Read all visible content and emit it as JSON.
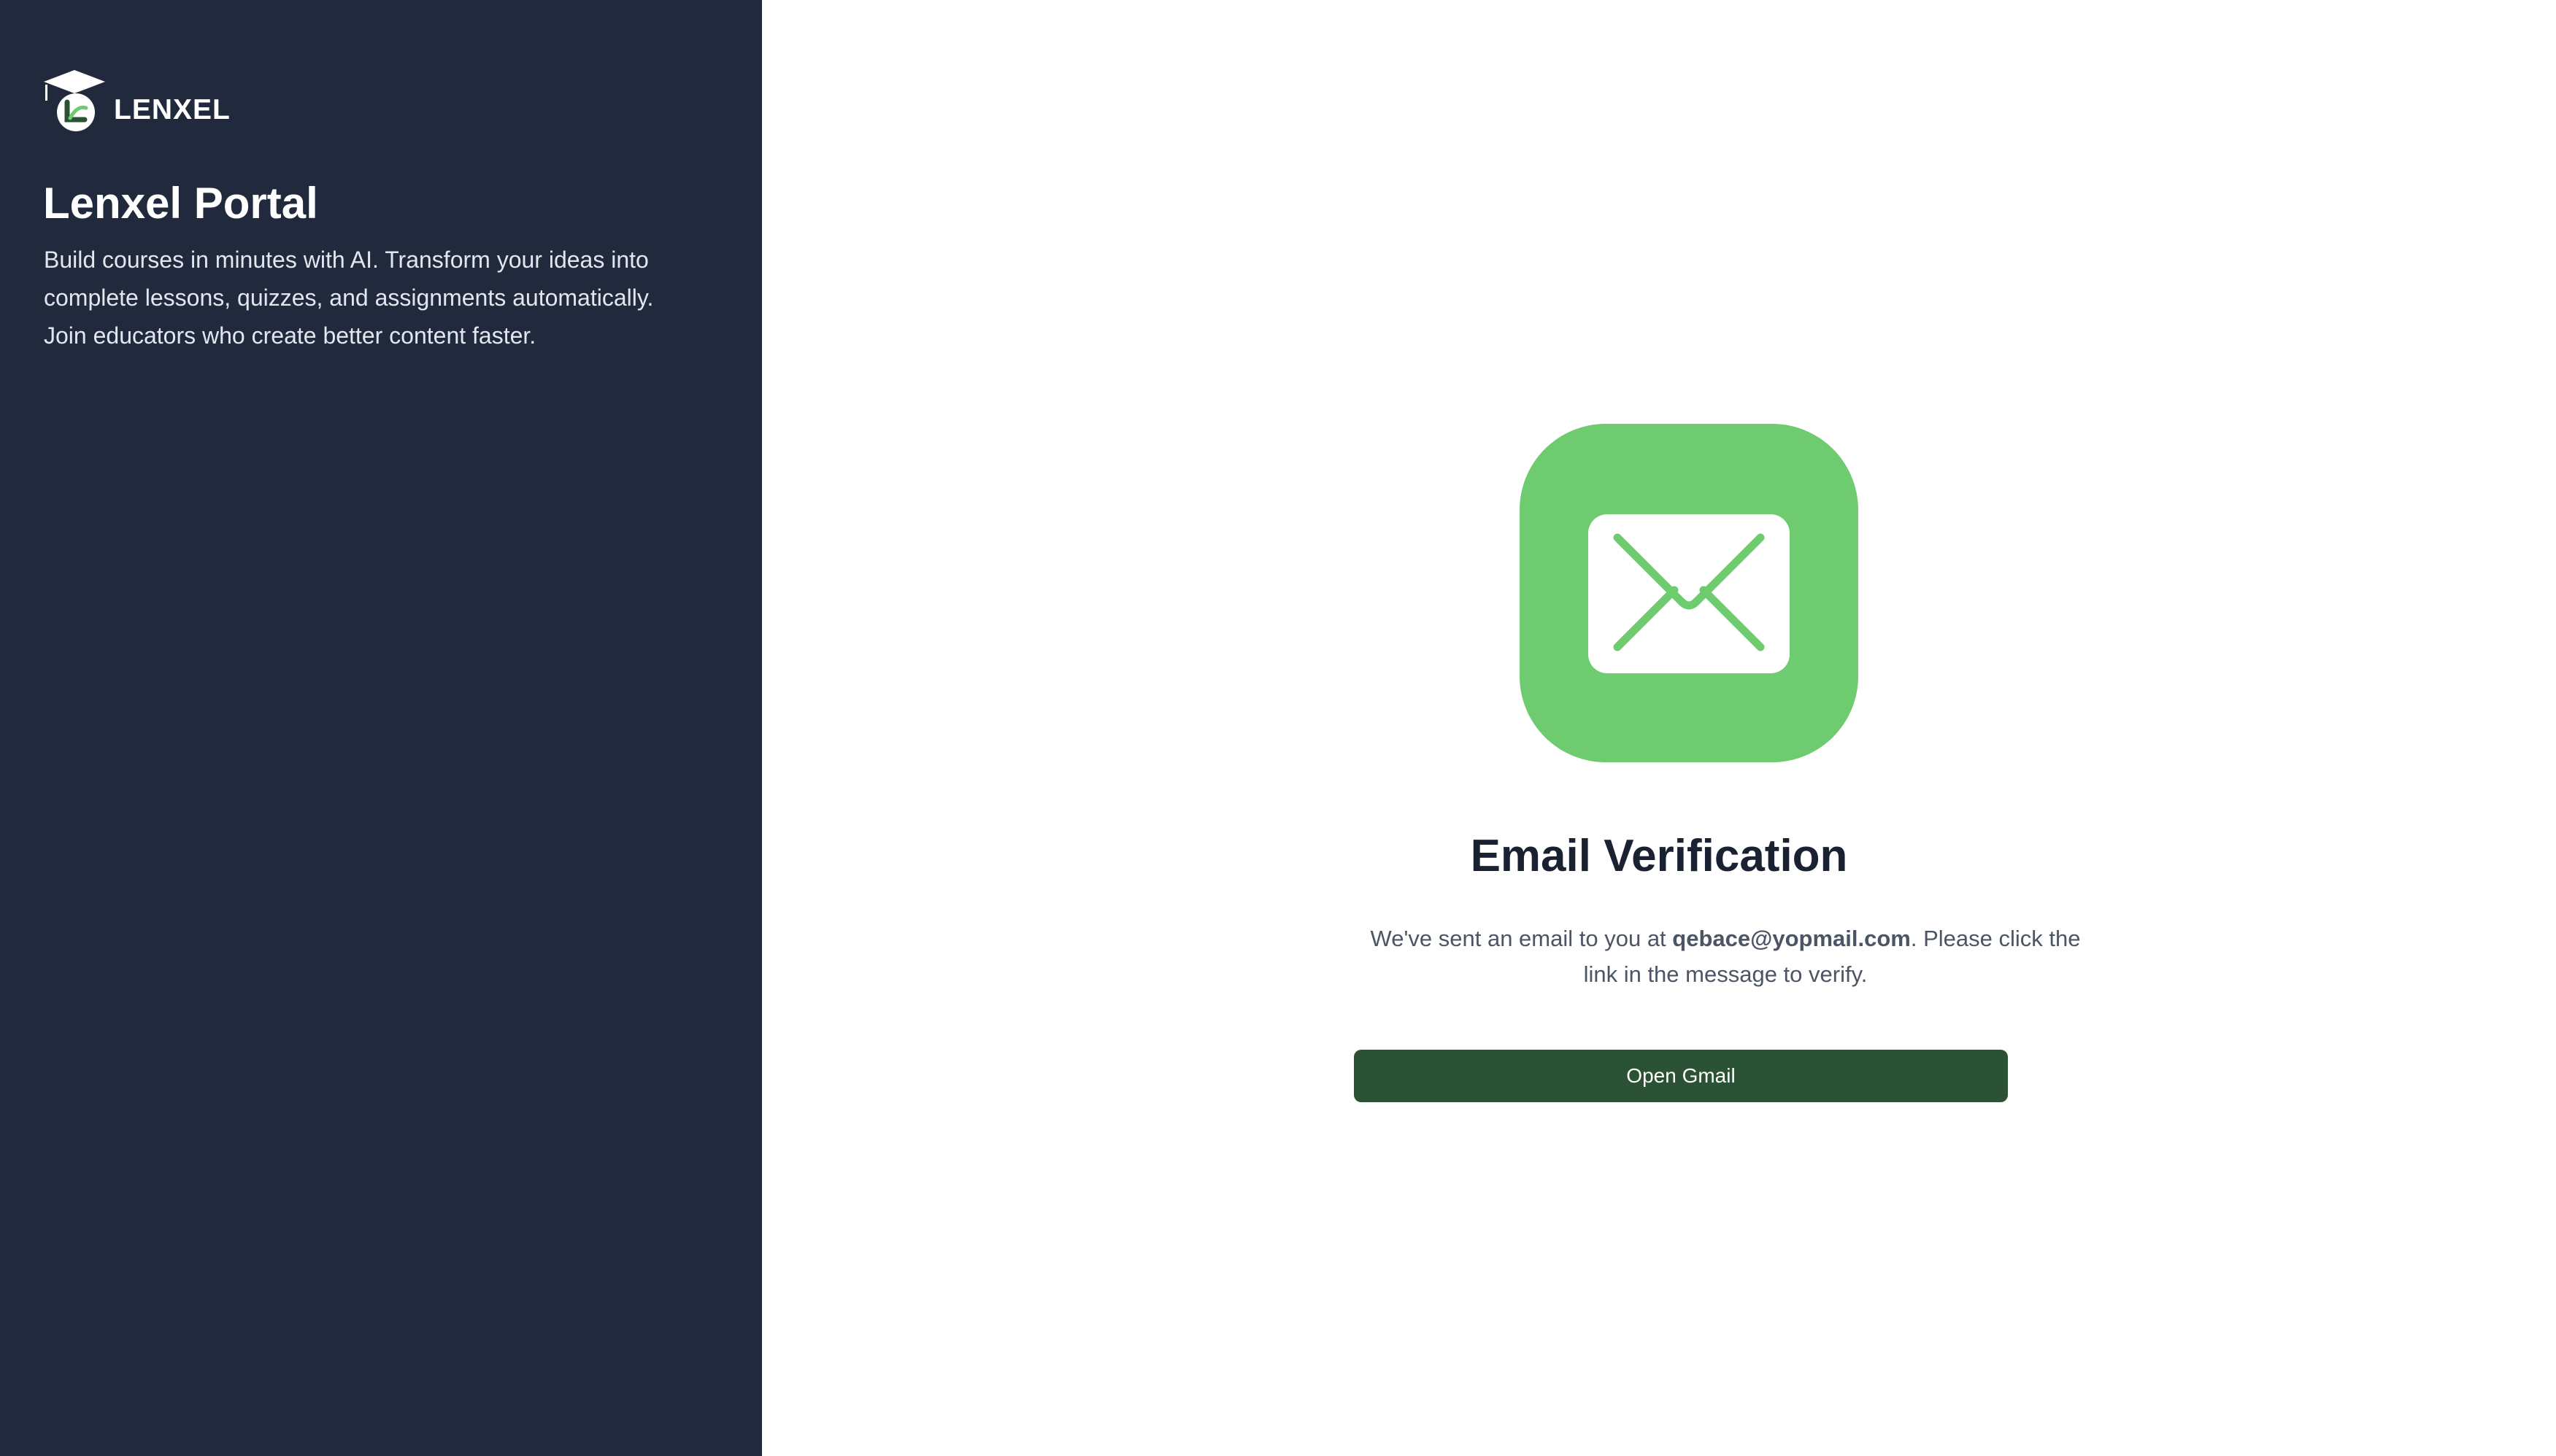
{
  "sidebar": {
    "brand_name": "LENXEL",
    "portal_title": "Lenxel Portal",
    "portal_description": "Build courses in minutes with AI. Transform your ideas into complete lessons, quizzes, and assignments automatically. Join educators who create better content faster."
  },
  "verification": {
    "icon": "envelope-icon",
    "title": "Email Verification",
    "message_prefix": "We've sent an email to you at ",
    "email": "qebace@yopmail.com",
    "message_suffix": ". Please click the link in the message to verify.",
    "button_label": "Open Gmail"
  },
  "colors": {
    "sidebar_bg": "#202a3c",
    "icon_green": "#6fcb6f",
    "button_green": "#2b5234"
  }
}
